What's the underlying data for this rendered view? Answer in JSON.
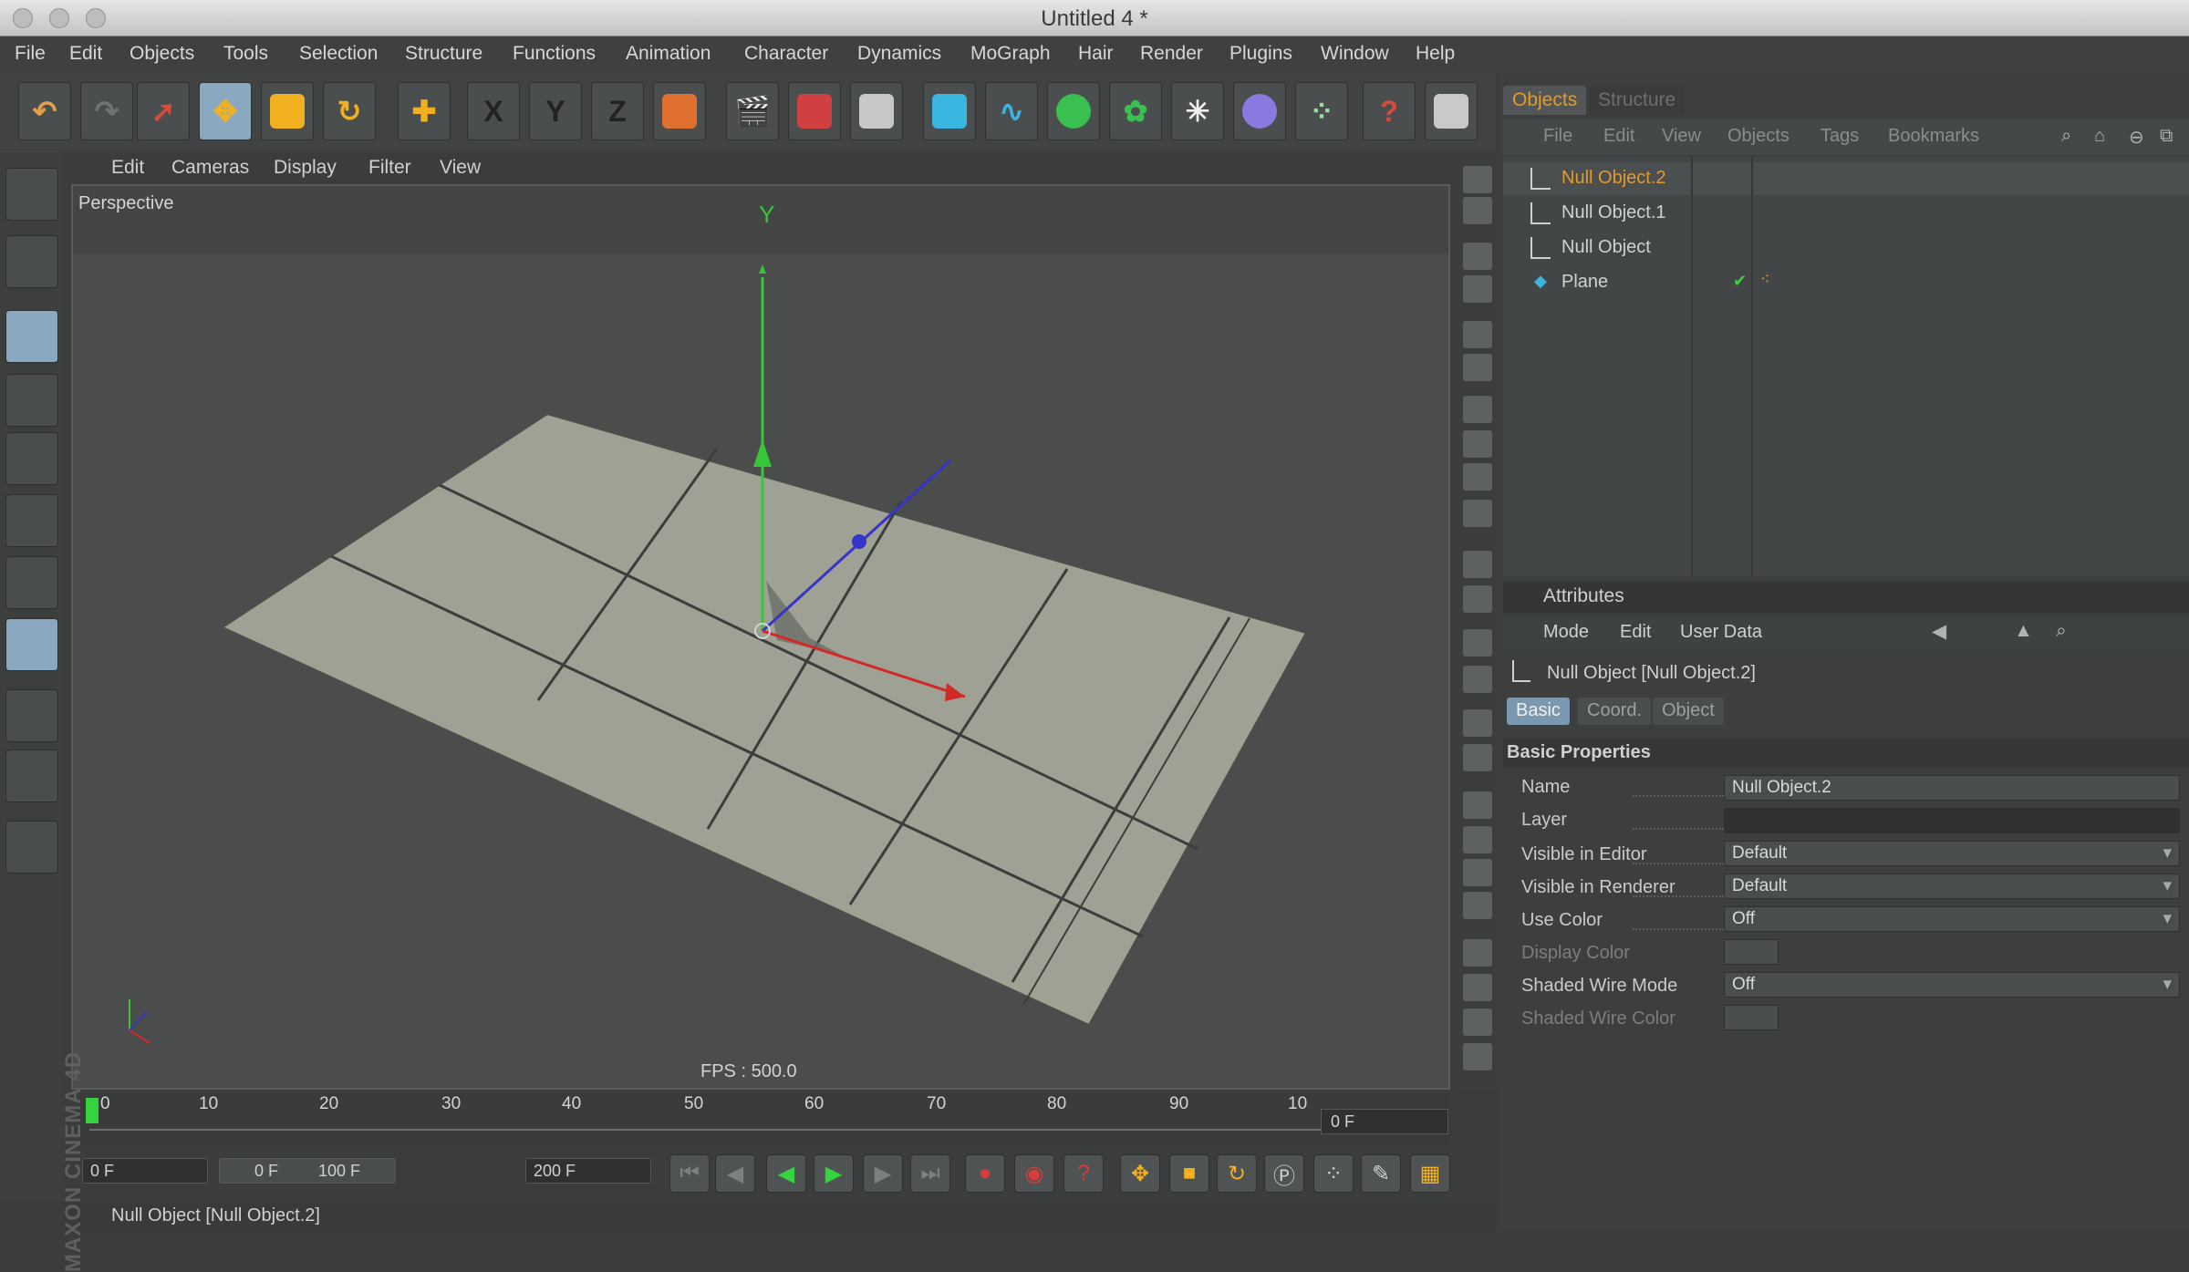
{
  "window": {
    "title": "Untitled 4 *"
  },
  "menu": [
    "File",
    "Edit",
    "Objects",
    "Tools",
    "Selection",
    "Structure",
    "Functions",
    "Animation",
    "Character",
    "Dynamics",
    "MoGraph",
    "Hair",
    "Render",
    "Plugins",
    "Window",
    "Help"
  ],
  "toolbar": {
    "axis_x": "X",
    "axis_y": "Y",
    "axis_z": "Z"
  },
  "viewport": {
    "menu": [
      "Edit",
      "Cameras",
      "Display",
      "Filter",
      "View"
    ],
    "label": "Perspective",
    "axis_y_label": "Y",
    "fps": "FPS : 500.0"
  },
  "timeline": {
    "ticks": [
      "0",
      "10",
      "20",
      "30",
      "40",
      "50",
      "60",
      "70",
      "80",
      "90",
      "10"
    ],
    "current_frame": "0 F",
    "start_field": "0 F",
    "range_min": "0 F",
    "range_max": "100 F",
    "end_field": "200 F"
  },
  "status": {
    "text": "Null Object [Null Object.2]"
  },
  "brand": {
    "text": "MAXON CINEMA 4D"
  },
  "object_manager": {
    "tabs": [
      "Objects",
      "Structure"
    ],
    "menu": [
      "File",
      "Edit",
      "View",
      "Objects",
      "Tags",
      "Bookmarks"
    ],
    "objects": [
      {
        "name": "Null Object.2",
        "active": true
      },
      {
        "name": "Null Object.1",
        "active": false
      },
      {
        "name": "Null Object",
        "active": false
      },
      {
        "name": "Plane",
        "active": false
      }
    ]
  },
  "attributes": {
    "header": "Attributes",
    "menu": [
      "Mode",
      "Edit",
      "User Data"
    ],
    "object_title": "Null Object [Null Object.2]",
    "tabs": [
      "Basic",
      "Coord.",
      "Object"
    ],
    "section": "Basic Properties",
    "props": {
      "name_label": "Name",
      "name_value": "Null Object.2",
      "layer_label": "Layer",
      "vis_editor_label": "Visible in Editor",
      "vis_editor_value": "Default",
      "vis_renderer_label": "Visible in Renderer",
      "vis_renderer_value": "Default",
      "use_color_label": "Use Color",
      "use_color_value": "Off",
      "display_color_label": "Display Color",
      "shaded_wire_mode_label": "Shaded Wire Mode",
      "shaded_wire_mode_value": "Off",
      "shaded_wire_color_label": "Shaded Wire Color"
    }
  }
}
